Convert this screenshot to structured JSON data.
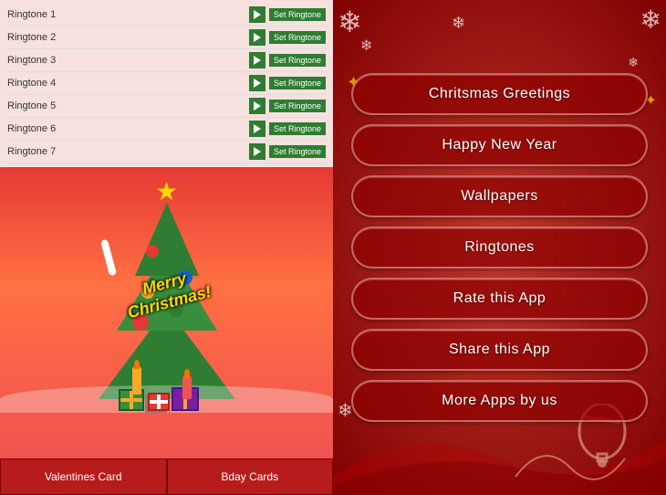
{
  "left": {
    "ringtones": [
      {
        "name": "Ringtone 1",
        "play": "play",
        "set": "Set Ringtone"
      },
      {
        "name": "Ringtone 2",
        "play": "play",
        "set": "Set Ringtone"
      },
      {
        "name": "Ringtone 3",
        "play": "play",
        "set": "Set Ringtone"
      },
      {
        "name": "Ringtone 4",
        "play": "play",
        "set": "Set Ringtone"
      },
      {
        "name": "Ringtone 5",
        "play": "play",
        "set": "Set Ringtone"
      },
      {
        "name": "Ringtone 6",
        "play": "play",
        "set": "Set Ringtone"
      },
      {
        "name": "Ringtone 7",
        "play": "play",
        "set": "Set Ringtone"
      }
    ],
    "merry_christmas": "Merry\nChristmas!",
    "bottom_buttons": [
      {
        "label": "Valentines Card"
      },
      {
        "label": "Bday Cards"
      }
    ]
  },
  "right": {
    "menu_items": [
      {
        "label": "Chritsmas Greetings",
        "key": "christmas-greetings"
      },
      {
        "label": "Happy New Year",
        "key": "happy-new-year"
      },
      {
        "label": "Wallpapers",
        "key": "wallpapers"
      },
      {
        "label": "Ringtones",
        "key": "ringtones"
      },
      {
        "label": "Rate this App",
        "key": "rate-app"
      },
      {
        "label": "Share this App",
        "key": "share-app"
      },
      {
        "label": "More Apps by us",
        "key": "more-apps"
      }
    ]
  }
}
